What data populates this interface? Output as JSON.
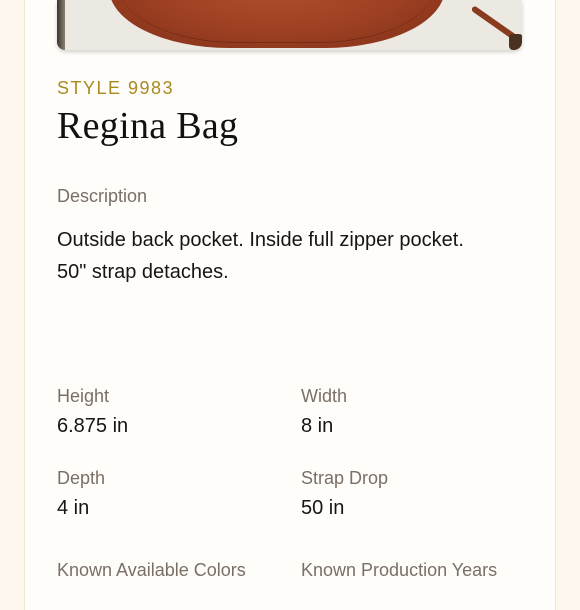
{
  "product": {
    "image_alt": "Red leather bag photo",
    "style_code": "STYLE 9983",
    "name": "Regina Bag"
  },
  "description": {
    "label": "Description",
    "text": "Outside back pocket. Inside full zipper pocket. 50\" strap detaches."
  },
  "specs": {
    "height": {
      "label": "Height",
      "value": "6.875 in"
    },
    "width": {
      "label": "Width",
      "value": "8 in"
    },
    "depth": {
      "label": "Depth",
      "value": "4 in"
    },
    "strap_drop": {
      "label": "Strap Drop",
      "value": "50 in"
    },
    "colors": {
      "label": "Known Available Colors"
    },
    "years": {
      "label": "Known Production Years"
    }
  },
  "colors": {
    "accent": "#a88a20",
    "bag": "#9c3f22",
    "background": "#fdf7ee"
  }
}
